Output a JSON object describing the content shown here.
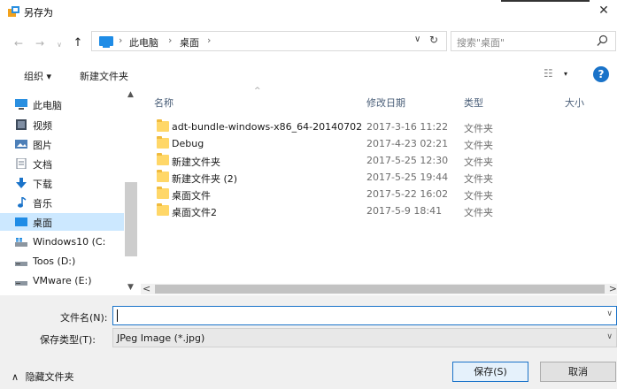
{
  "window": {
    "title": "另存为",
    "close_glyph": "✕"
  },
  "nav_buttons": {
    "back": "←",
    "forward": "→",
    "up": "↑"
  },
  "address": {
    "crumbs": [
      "此电脑",
      "桌面"
    ],
    "separator": "›",
    "dropdown_glyph": "∨",
    "refresh_glyph": "↻"
  },
  "search": {
    "placeholder": "搜索\"桌面\"",
    "icon": "search-icon"
  },
  "toolbar": {
    "organize_label": "组织 ▾",
    "new_folder_label": "新建文件夹",
    "view_glyph": "☷",
    "view_arrow": "▾",
    "help_glyph": "?"
  },
  "sidebar": {
    "items": [
      {
        "label": "此电脑",
        "icon": "computer-icon"
      },
      {
        "label": "视频",
        "icon": "video-icon"
      },
      {
        "label": "图片",
        "icon": "picture-icon"
      },
      {
        "label": "文档",
        "icon": "document-icon"
      },
      {
        "label": "下载",
        "icon": "download-icon"
      },
      {
        "label": "音乐",
        "icon": "music-icon"
      },
      {
        "label": "桌面",
        "icon": "desktop-icon",
        "selected": true
      },
      {
        "label": "Windows10 (C:",
        "icon": "drive-icon"
      },
      {
        "label": "Toos (D:)",
        "icon": "drive-icon"
      },
      {
        "label": "VMware (E:)",
        "icon": "drive-icon"
      }
    ],
    "scroll_up": "▲",
    "scroll_down": "▼"
  },
  "file_list": {
    "columns": {
      "name": "名称",
      "modified": "修改日期",
      "type": "类型",
      "size": "大小"
    },
    "sort_glyph": "^",
    "rows": [
      {
        "name": "adt-bundle-windows-x86_64-20140702",
        "modified": "2017-3-16 11:22",
        "type": "文件夹"
      },
      {
        "name": "Debug",
        "modified": "2017-4-23 02:21",
        "type": "文件夹"
      },
      {
        "name": "新建文件夹",
        "modified": "2017-5-25 12:30",
        "type": "文件夹"
      },
      {
        "name": "新建文件夹 (2)",
        "modified": "2017-5-25 19:44",
        "type": "文件夹"
      },
      {
        "name": "桌面文件",
        "modified": "2017-5-22 16:02",
        "type": "文件夹"
      },
      {
        "name": "桌面文件2",
        "modified": "2017-5-9 18:41",
        "type": "文件夹"
      }
    ],
    "hscroll_left": "<",
    "hscroll_right": ">"
  },
  "form": {
    "filename_label": "文件名(N):",
    "filename_value": "",
    "filetype_label": "保存类型(T):",
    "filetype_value": "JPeg Image (*.jpg)",
    "dropdown_glyph": "∨"
  },
  "footer": {
    "hide_folders_label": "隐藏文件夹",
    "hide_arrow": "∧",
    "save_label": "保存(S)",
    "cancel_label": "取消"
  },
  "colors": {
    "accent": "#1a73c9",
    "selection": "#cce8ff",
    "folder": "#ffd768"
  }
}
